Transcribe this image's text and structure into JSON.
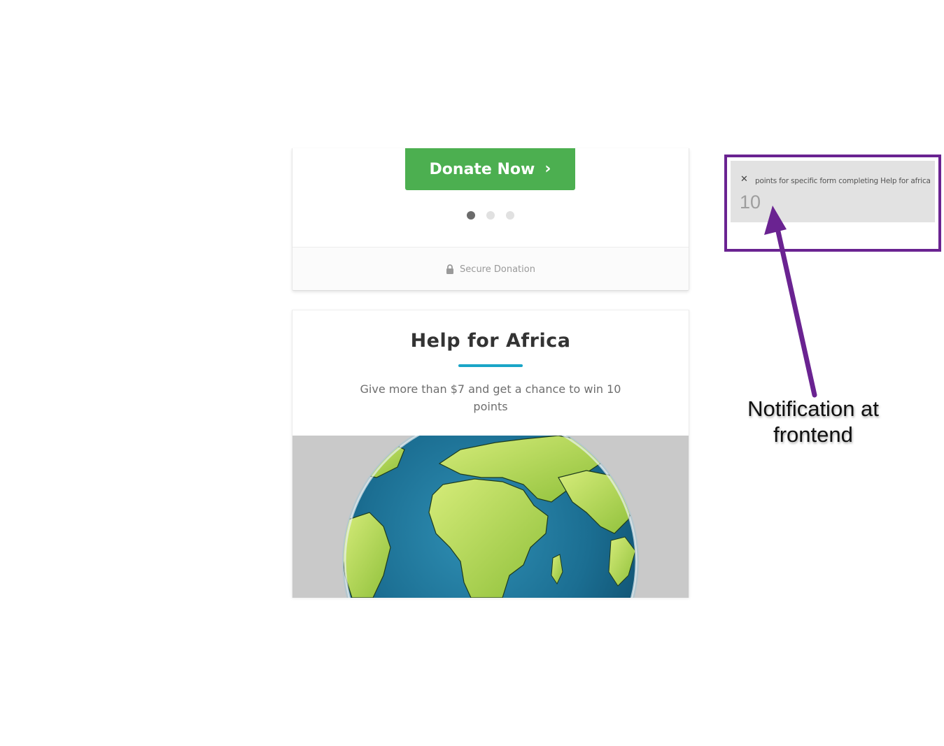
{
  "top_card": {
    "donate_button": {
      "label": "Donate Now",
      "chevron": "›",
      "color": "#4caf50"
    },
    "carousel": {
      "count": 3,
      "active_index": 0
    },
    "secure_label": "Secure Donation",
    "secure_icon": "lock-icon"
  },
  "form_card": {
    "title": "Help for Africa",
    "underline_color": "#1aa5c7",
    "description": "Give more than $7 and get a chance to win 10 points",
    "image": "globe-africa-image"
  },
  "notification": {
    "close_symbol": "✕",
    "message": "points for specific form completing Help for africa",
    "points": "10",
    "frame_color": "#6a2391"
  },
  "annotation": {
    "label_line1": "Notification at",
    "label_line2": "frontend",
    "arrow_color": "#6a2391"
  }
}
